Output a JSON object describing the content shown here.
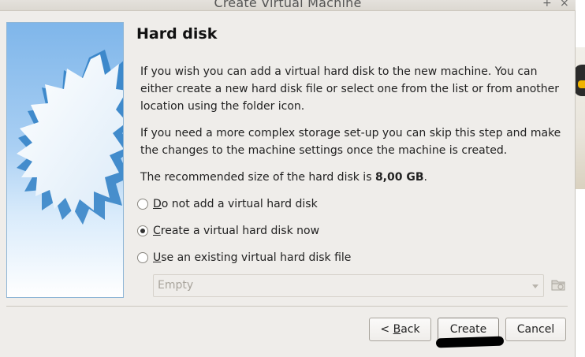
{
  "window": {
    "title": "Create Virtual Machine",
    "maximize_glyph": "+",
    "close_glyph": "×"
  },
  "page": {
    "heading": "Hard disk",
    "para1": "If you wish you can add a virtual hard disk to the new machine. You can either create a new hard disk file or select one from the list or from another location using the folder icon.",
    "para2": "If you need a more complex storage set-up you can skip this step and make the changes to the machine settings once the machine is created.",
    "recommended_prefix": "The recommended size of the hard disk is ",
    "recommended_size": "8,00 GB",
    "recommended_suffix": "."
  },
  "options": {
    "no_disk": {
      "mnemonic": "D",
      "rest": "o not add a virtual hard disk",
      "checked": false
    },
    "create_disk": {
      "mnemonic": "C",
      "rest": "reate a virtual hard disk now",
      "checked": true
    },
    "use_existing": {
      "mnemonic": "U",
      "rest": "se an existing virtual hard disk file",
      "checked": false
    }
  },
  "existing_disk_select": {
    "value": "Empty"
  },
  "buttons": {
    "back_prefix": "< ",
    "back_mnemonic": "B",
    "back_rest": "ack",
    "create": "Create",
    "cancel": "Cancel"
  },
  "icons": {
    "side_image": "starburst-icon",
    "folder": "folder-icon"
  },
  "colors": {
    "dialog_bg": "#efedea",
    "side_gradient_top": "#7fb6ea",
    "star_fill": "#e9f4fd",
    "star_edge": "#2f7fc4"
  }
}
